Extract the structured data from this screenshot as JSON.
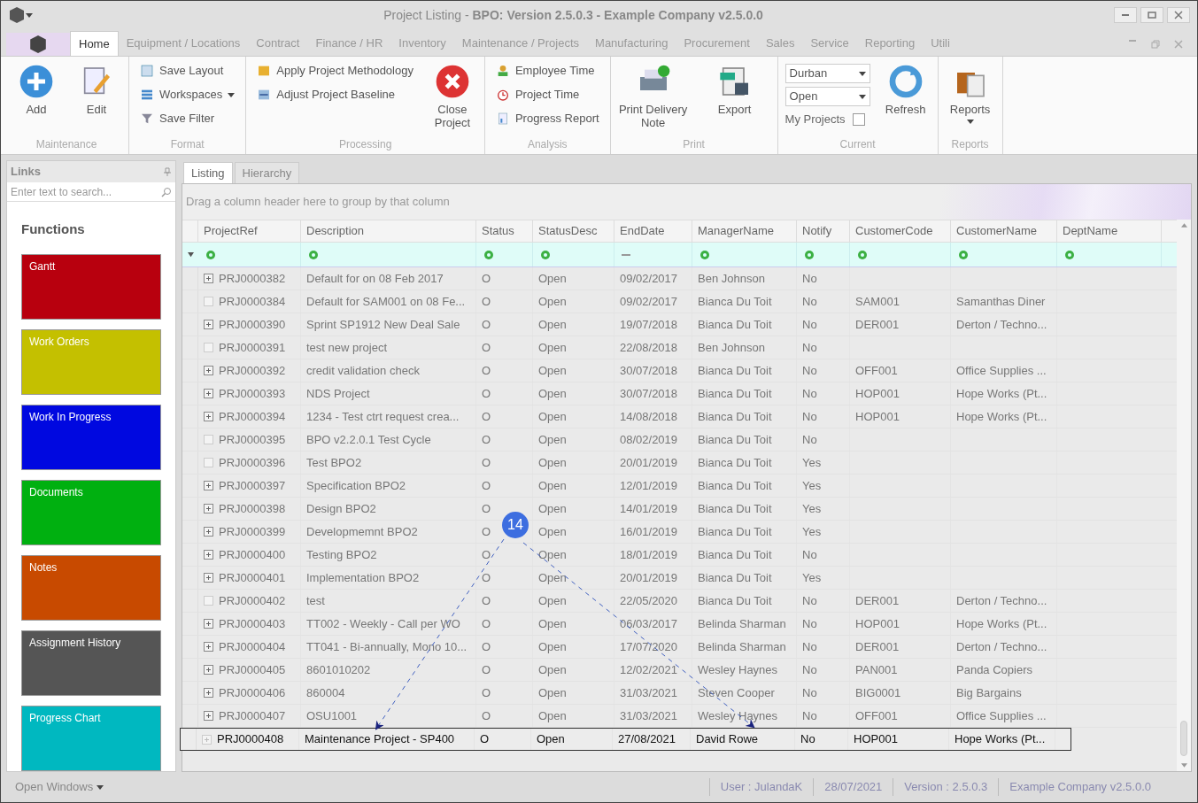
{
  "window": {
    "title_plain": "Project Listing - ",
    "title_bold": "BPO: Version 2.5.0.3 - Example Company v2.5.0.0"
  },
  "menu_tabs": [
    {
      "label": "Home",
      "selected": true
    },
    {
      "label": "Equipment / Locations",
      "selected": false
    },
    {
      "label": "Contract",
      "selected": false
    },
    {
      "label": "Finance / HR",
      "selected": false
    },
    {
      "label": "Inventory",
      "selected": false
    },
    {
      "label": "Maintenance / Projects",
      "selected": false
    },
    {
      "label": "Manufacturing",
      "selected": false
    },
    {
      "label": "Procurement",
      "selected": false
    },
    {
      "label": "Sales",
      "selected": false
    },
    {
      "label": "Service",
      "selected": false
    },
    {
      "label": "Reporting",
      "selected": false
    },
    {
      "label": "Utili",
      "selected": false
    }
  ],
  "ribbon_groups": [
    {
      "label": "Maintenance",
      "items": [
        {
          "kind": "big",
          "label": "Add"
        },
        {
          "kind": "big",
          "label": "Edit"
        }
      ]
    },
    {
      "label": "Format",
      "items": [
        {
          "kind": "small",
          "label": "Save Layout"
        },
        {
          "kind": "small",
          "label": "Workspaces",
          "dropdown": true
        },
        {
          "kind": "small",
          "label": "Save Filter"
        }
      ]
    },
    {
      "label": "Processing",
      "items": [
        {
          "kind": "small",
          "label": "Apply Project Methodology"
        },
        {
          "kind": "small",
          "label": "Adjust Project Baseline"
        },
        {
          "kind": "big",
          "label": "Close Project"
        }
      ]
    },
    {
      "label": "Analysis",
      "items": [
        {
          "kind": "small",
          "label": "Employee Time"
        },
        {
          "kind": "small",
          "label": "Project Time"
        },
        {
          "kind": "small",
          "label": "Progress Report"
        }
      ]
    },
    {
      "label": "Print",
      "items": [
        {
          "kind": "big",
          "label": "Print Delivery Note"
        },
        {
          "kind": "big",
          "label": "Export"
        }
      ]
    },
    {
      "label": "Current",
      "items": [
        {
          "kind": "combo",
          "value": "Durban"
        },
        {
          "kind": "combo",
          "value": "Open"
        },
        {
          "kind": "check",
          "label": "My Projects",
          "checked": false
        },
        {
          "kind": "big",
          "label": "Refresh"
        }
      ]
    },
    {
      "label": "Reports",
      "items": [
        {
          "kind": "big",
          "label": "Reports",
          "dropdown": true
        }
      ]
    }
  ],
  "links": {
    "title": "Links",
    "search_placeholder": "Enter text to search...",
    "section": "Functions",
    "tiles": [
      {
        "label": "Gantt",
        "color": "#b8000e"
      },
      {
        "label": "Work Orders",
        "color": "#c4c000"
      },
      {
        "label": "Work In Progress",
        "color": "#0008e0"
      },
      {
        "label": "Documents",
        "color": "#00b010"
      },
      {
        "label": "Notes",
        "color": "#c84a00"
      },
      {
        "label": "Assignment History",
        "color": "#555555"
      },
      {
        "label": "Progress Chart",
        "color": "#00b8c0"
      }
    ]
  },
  "view_tabs": [
    {
      "label": "Listing",
      "selected": true
    },
    {
      "label": "Hierarchy",
      "selected": false
    }
  ],
  "group_panel": "Drag a column header here to group by that column",
  "columns": [
    "ProjectRef",
    "Description",
    "Status",
    "StatusDesc",
    "EndDate",
    "ManagerName",
    "Notify",
    "CustomerCode",
    "CustomerName",
    "DeptName"
  ],
  "rows": [
    {
      "expandable": true,
      "selected": false,
      "cells": [
        "PRJ0000382",
        "Default for  on 08 Feb 2017",
        "O",
        "Open",
        "09/02/2017",
        "Ben Johnson",
        "No",
        "",
        ""
      ]
    },
    {
      "expandable": false,
      "selected": false,
      "cells": [
        "PRJ0000384",
        "Default for SAM001 on 08 Fe...",
        "O",
        "Open",
        "09/02/2017",
        "Bianca Du Toit",
        "No",
        "SAM001",
        "Samanthas Diner"
      ]
    },
    {
      "expandable": true,
      "selected": false,
      "cells": [
        "PRJ0000390",
        "Sprint SP1912 New Deal Sale",
        "O",
        "Open",
        "19/07/2018",
        "Bianca Du Toit",
        "No",
        "DER001",
        "Derton / Techno..."
      ]
    },
    {
      "expandable": false,
      "selected": false,
      "cells": [
        "PRJ0000391",
        "test new project",
        "O",
        "Open",
        "22/08/2018",
        "Ben Johnson",
        "No",
        "",
        ""
      ]
    },
    {
      "expandable": true,
      "selected": false,
      "cells": [
        "PRJ0000392",
        "credit validation check",
        "O",
        "Open",
        "30/07/2018",
        "Bianca Du Toit",
        "No",
        "OFF001",
        "Office Supplies ..."
      ]
    },
    {
      "expandable": true,
      "selected": false,
      "cells": [
        "PRJ0000393",
        "NDS Project",
        "O",
        "Open",
        "30/07/2018",
        "Bianca Du Toit",
        "No",
        "HOP001",
        "Hope Works (Pt..."
      ]
    },
    {
      "expandable": true,
      "selected": false,
      "cells": [
        "PRJ0000394",
        "1234 - Test ctrt request crea...",
        "O",
        "Open",
        "14/08/2018",
        "Bianca Du Toit",
        "No",
        "HOP001",
        "Hope Works (Pt..."
      ]
    },
    {
      "expandable": false,
      "selected": false,
      "cells": [
        "PRJ0000395",
        "BPO v2.2.0.1 Test Cycle",
        "O",
        "Open",
        "08/02/2019",
        "Bianca Du Toit",
        "No",
        "",
        ""
      ]
    },
    {
      "expandable": false,
      "selected": false,
      "cells": [
        "PRJ0000396",
        "Test BPO2",
        "O",
        "Open",
        "20/01/2019",
        "Bianca Du Toit",
        "Yes",
        "",
        ""
      ]
    },
    {
      "expandable": true,
      "selected": false,
      "cells": [
        "PRJ0000397",
        "Specification BPO2",
        "O",
        "Open",
        "12/01/2019",
        "Bianca Du Toit",
        "Yes",
        "",
        ""
      ]
    },
    {
      "expandable": true,
      "selected": false,
      "cells": [
        "PRJ0000398",
        "Design BPO2",
        "O",
        "Open",
        "14/01/2019",
        "Bianca Du Toit",
        "Yes",
        "",
        ""
      ]
    },
    {
      "expandable": true,
      "selected": false,
      "cells": [
        "PRJ0000399",
        "Developmemnt BPO2",
        "O",
        "Open",
        "16/01/2019",
        "Bianca Du Toit",
        "Yes",
        "",
        ""
      ]
    },
    {
      "expandable": true,
      "selected": false,
      "cells": [
        "PRJ0000400",
        "Testing BPO2",
        "O",
        "Open",
        "18/01/2019",
        "Bianca Du Toit",
        "No",
        "",
        ""
      ]
    },
    {
      "expandable": true,
      "selected": false,
      "cells": [
        "PRJ0000401",
        "Implementation BPO2",
        "O",
        "Open",
        "20/01/2019",
        "Bianca Du Toit",
        "Yes",
        "",
        ""
      ]
    },
    {
      "expandable": false,
      "selected": false,
      "cells": [
        "PRJ0000402",
        "test",
        "O",
        "Open",
        "22/05/2020",
        "Bianca Du Toit",
        "No",
        "DER001",
        "Derton / Techno..."
      ]
    },
    {
      "expandable": true,
      "selected": false,
      "cells": [
        "PRJ0000403",
        "TT002 - Weekly - Call per WO",
        "O",
        "Open",
        "06/03/2017",
        "Belinda Sharman",
        "No",
        "HOP001",
        "Hope Works (Pt..."
      ]
    },
    {
      "expandable": true,
      "selected": false,
      "cells": [
        "PRJ0000404",
        "TT041 - Bi-annually, Mono 10...",
        "O",
        "Open",
        "17/07/2020",
        "Belinda Sharman",
        "No",
        "DER001",
        "Derton / Techno..."
      ]
    },
    {
      "expandable": true,
      "selected": false,
      "cells": [
        "PRJ0000405",
        "8601010202",
        "O",
        "Open",
        "12/02/2021",
        "Wesley Haynes",
        "No",
        "PAN001",
        "Panda Copiers"
      ]
    },
    {
      "expandable": true,
      "selected": false,
      "cells": [
        "PRJ0000406",
        "860004",
        "O",
        "Open",
        "31/03/2021",
        "Steven Cooper",
        "No",
        "BIG0001",
        "Big Bargains"
      ]
    },
    {
      "expandable": true,
      "selected": false,
      "cells": [
        "PRJ0000407",
        "OSU1001",
        "O",
        "Open",
        "31/03/2021",
        "Wesley Haynes",
        "No",
        "OFF001",
        "Office Supplies ..."
      ]
    },
    {
      "expandable": true,
      "selected": true,
      "cells": [
        "PRJ0000408",
        "Maintenance Project - SP400",
        "O",
        "Open",
        "27/08/2021",
        "David Rowe",
        "No",
        "HOP001",
        "Hope Works (Pt..."
      ]
    }
  ],
  "callout": {
    "number": "14"
  },
  "status_bar": {
    "open_windows": "Open Windows",
    "fields": [
      "User : JulandaK",
      "28/07/2021",
      "Version : 2.5.0.3",
      "Example Company v2.5.0.0"
    ]
  }
}
